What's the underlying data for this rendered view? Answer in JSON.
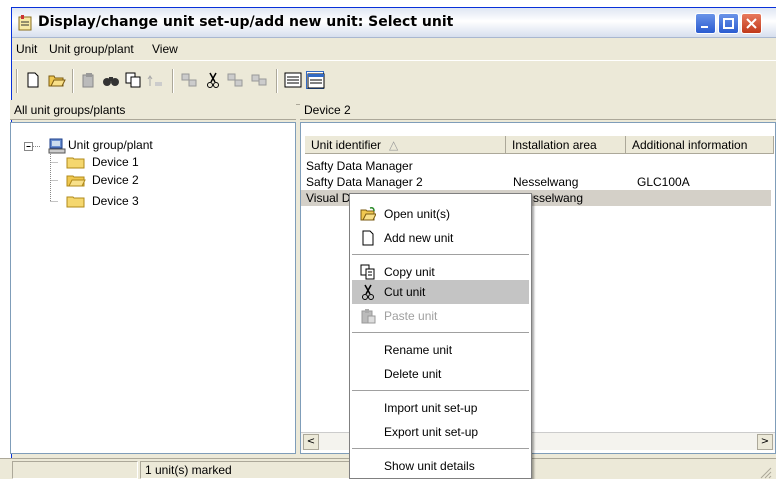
{
  "window": {
    "title": "Display/change unit set-up/add new unit: Select unit"
  },
  "menu": {
    "items": [
      "Unit",
      "Unit group/plant",
      "View"
    ]
  },
  "toolbar": {
    "icons": [
      "new-icon",
      "open-icon",
      "copy-disabled-icon",
      "find-icon",
      "copy-icon",
      "up-icon",
      "import-icon",
      "cut-icon",
      "paste-icon",
      "export-icon",
      "list-view-icon",
      "details-view-icon"
    ]
  },
  "left_panel": {
    "header": "All unit groups/plants",
    "tree": {
      "root": "Unit group/plant",
      "children": [
        "Device 1",
        "Device 2",
        "Device 3"
      ],
      "selected": "Device 2"
    }
  },
  "right_panel": {
    "header": "Device 2",
    "columns": [
      "Unit identifier",
      "Installation area",
      "Additional information"
    ],
    "rows": [
      {
        "id": "Safty Data Manager",
        "area": "",
        "info": ""
      },
      {
        "id": "Safty Data Manager 2",
        "area": "Nesselwang",
        "info": "GLC100A"
      },
      {
        "id": "Visual D",
        "area": "sselwang",
        "info": ""
      }
    ]
  },
  "context_menu": {
    "groups": [
      [
        {
          "label": "Open unit(s)",
          "icon": "open-folder-icon"
        },
        {
          "label": "Add new unit",
          "icon": "new-doc-icon"
        }
      ],
      [
        {
          "label": "Copy unit",
          "icon": "copy-icon"
        },
        {
          "label": "Cut unit",
          "icon": "scissors-icon",
          "highlighted": true
        },
        {
          "label": "Paste unit",
          "icon": "paste-icon",
          "disabled": true
        }
      ],
      [
        {
          "label": "Rename unit"
        },
        {
          "label": "Delete unit"
        }
      ],
      [
        {
          "label": "Import unit set-up"
        },
        {
          "label": "Export unit set-up"
        }
      ],
      [
        {
          "label": "Show unit details"
        }
      ]
    ]
  },
  "status": {
    "marked": "1 unit(s) marked"
  },
  "colors": {
    "title_gradient": "#dfe6f3",
    "highlight": "#c4c4c4",
    "border": "#7f9db9",
    "folder": "#f5d76e"
  }
}
